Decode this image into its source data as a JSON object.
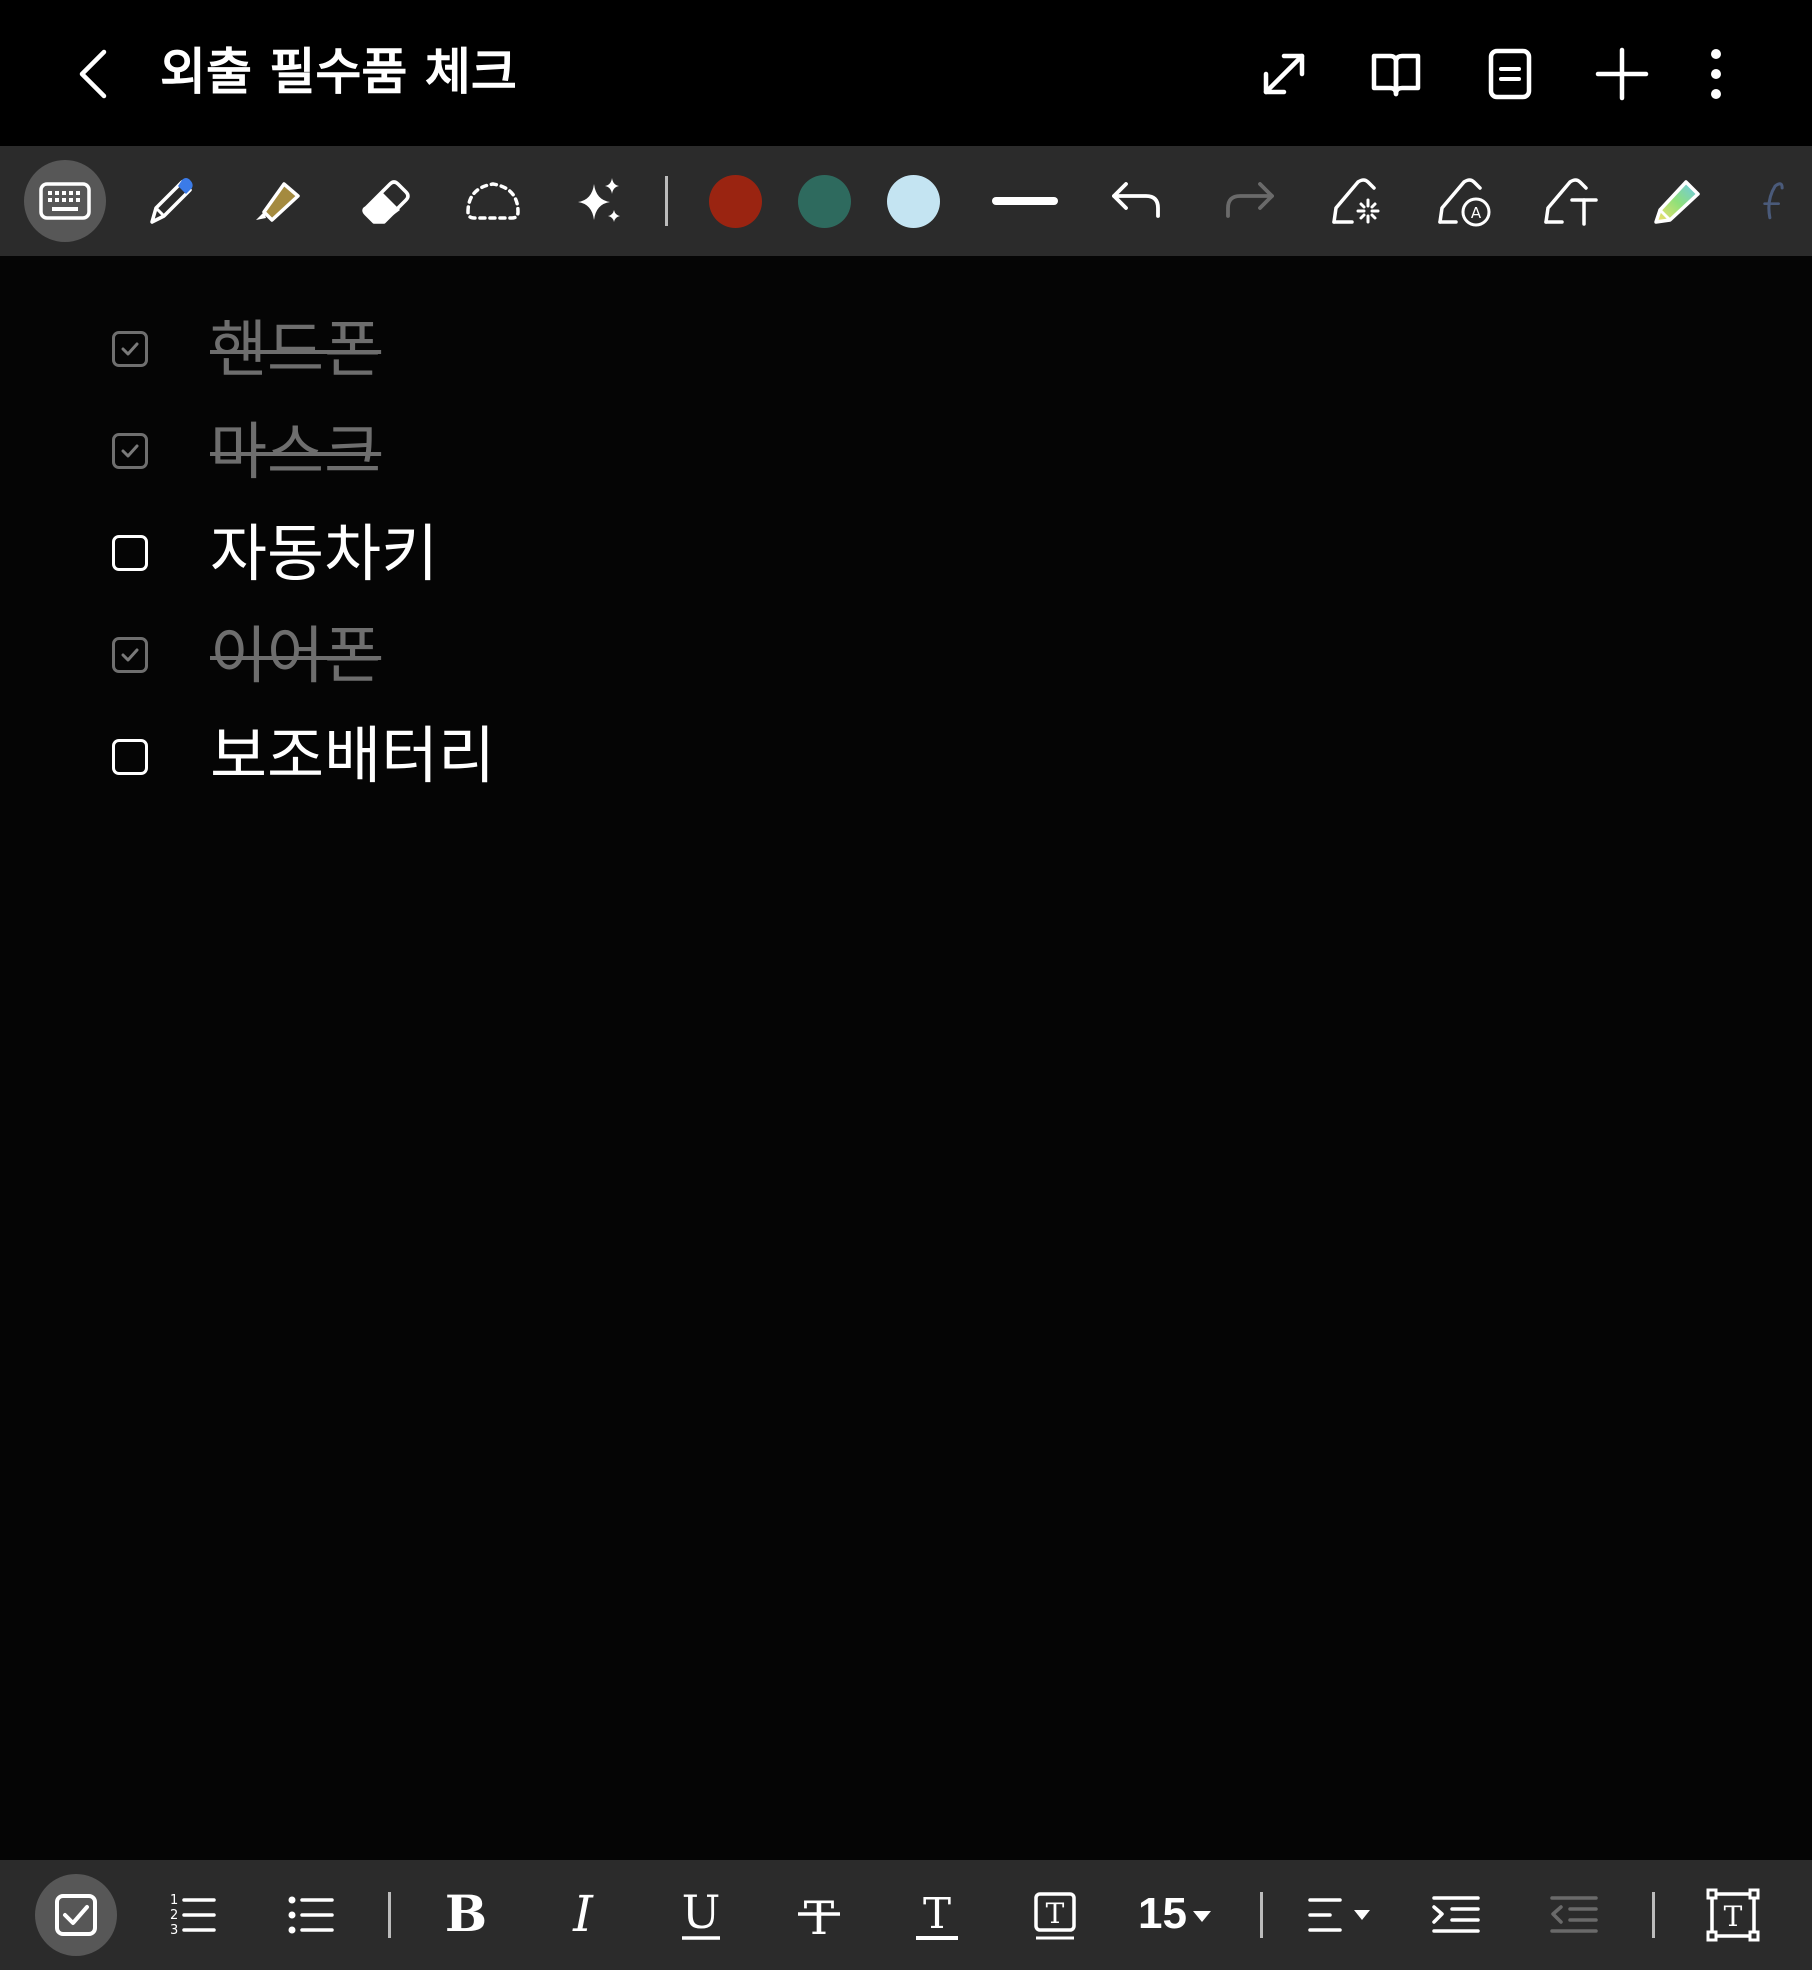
{
  "header": {
    "title": "외출 필수품 체크",
    "actions": [
      "expand-icon",
      "book-view-icon",
      "page-view-icon",
      "add-icon",
      "more-options-icon"
    ]
  },
  "pen_toolbar": {
    "tools": [
      "keyboard-icon",
      "pen-icon",
      "highlighter-icon",
      "eraser-icon",
      "lasso-select-icon",
      "ai-sparkle-icon"
    ],
    "colors": [
      "#9a2411",
      "#2e6a5e",
      "#c4e4f2"
    ],
    "tail_tools": [
      "stroke-width-icon",
      "undo-icon",
      "redo-icon",
      "spell-check-pen-icon",
      "handwriting-convert-icon",
      "text-convert-icon",
      "rainbow-pen-icon"
    ]
  },
  "checklist": {
    "items": [
      {
        "text": "핸드폰",
        "checked": true
      },
      {
        "text": "마스크",
        "checked": true
      },
      {
        "text": "자동차키",
        "checked": false
      },
      {
        "text": "이어폰",
        "checked": true
      },
      {
        "text": "보조배터리",
        "checked": false
      }
    ]
  },
  "format_bar": {
    "font_size": "15",
    "tools": [
      "checklist-icon",
      "numbered-list-icon",
      "bullet-list-icon",
      "bold-icon",
      "italic-icon",
      "underline-icon",
      "strikethrough-icon",
      "text-color-icon",
      "text-background-icon",
      "align-icon",
      "indent-icon",
      "outdent-icon",
      "text-box-icon"
    ]
  }
}
